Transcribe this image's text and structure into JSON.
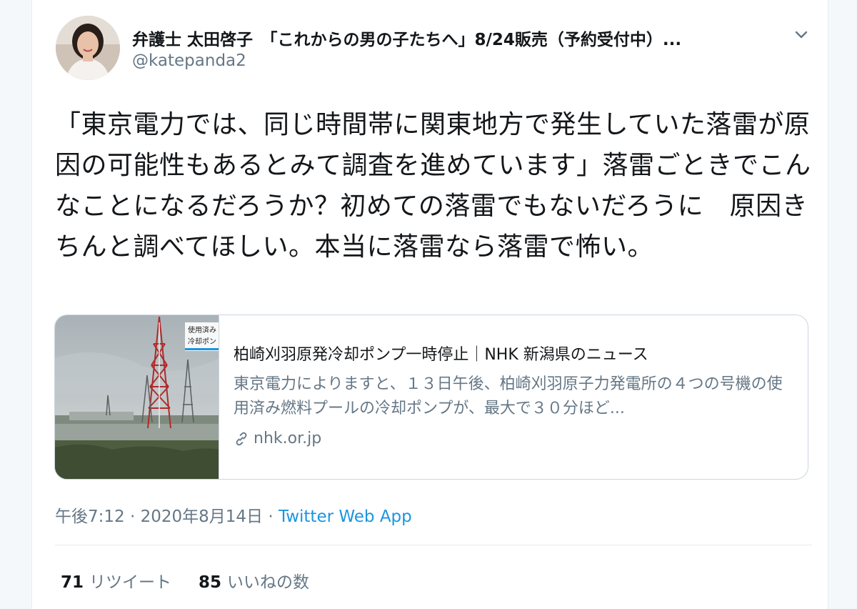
{
  "author": {
    "display_name": "弁護士 太田啓子　「これからの男の子たちへ」8/24販売（予約受付中）...",
    "handle": "@katepanda2"
  },
  "icons": {
    "menu": "chevron-down-icon",
    "link": "link-icon",
    "avatar": "avatar-photo"
  },
  "tweet": {
    "text": "「東京電力では、同じ時間帯に関東地方で発生していた落雷が原因の可能性もあるとみて調査を進めています」落雷ごときでこんなことになるだろうか？初めての落雷でもないだろうに　原因きちんと調べてほしい。本当に落雷なら落雷で怖い。"
  },
  "link_card": {
    "thumb_caption_line1": "使用済み",
    "thumb_caption_line2": "冷却ポン",
    "title": "柏崎刈羽原発冷却ポンプ一時停止｜NHK 新潟県のニュース",
    "description": "東京電力によりますと、１３日午後、柏崎刈羽原子力発電所の４つの号機の使用済み燃料プールの冷却ポンプが、最大で３０分ほど...",
    "domain": "nhk.or.jp"
  },
  "meta": {
    "time": "午後7:12",
    "separator": " · ",
    "date": "2020年8月14日",
    "source": "Twitter Web App"
  },
  "stats": {
    "retweets_count": "71",
    "retweets_label": "リツイート",
    "likes_count": "85",
    "likes_label": "いいねの数"
  },
  "colors": {
    "link_blue": "#1b95e0",
    "secondary_text": "#657786",
    "primary_text": "#14171a",
    "border": "#ccd6dd"
  }
}
